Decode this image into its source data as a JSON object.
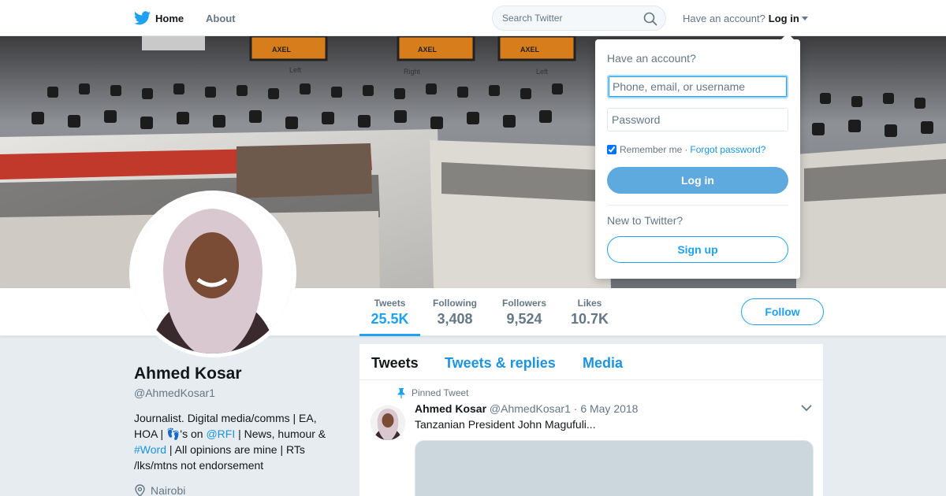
{
  "nav": {
    "home_label": "Home",
    "about_label": "About",
    "search_placeholder": "Search Twitter",
    "account_prompt": "Have an account?",
    "login_label": "Log in"
  },
  "colors": {
    "brand": "#1da1f2",
    "login_button": "#5ea9dd",
    "background": "#e6ecf0"
  },
  "icons": {
    "nav_home": "twitter-bird-icon",
    "search": "search-icon",
    "caret": "caret-down-icon",
    "pinned": "pin-icon",
    "location": "location-pin-icon",
    "tweet_menu": "chevron-down-icon"
  },
  "banner": {
    "vu_labels": [
      "Left",
      "Right",
      "Left"
    ],
    "meter_brand": "AXEL"
  },
  "stats": [
    {
      "label": "Tweets",
      "value": "25.5K"
    },
    {
      "label": "Following",
      "value": "3,408"
    },
    {
      "label": "Followers",
      "value": "9,524"
    },
    {
      "label": "Likes",
      "value": "10.7K"
    }
  ],
  "follow_label": "Follow",
  "profile": {
    "name": "Ahmed Kosar",
    "handle": "@AhmedKosar1",
    "bio_part1": "Journalist. Digital media/comms | EA, HOA | ",
    "bio_emoji": "👣",
    "bio_part2": "'s on ",
    "bio_mention": "@RFI",
    "bio_part3": " | News, humour & ",
    "bio_hashtag": "#Word",
    "bio_part4": " | All opinions are mine | RTs /lks/mtns not endorsement",
    "location": "Nairobi"
  },
  "timeline": {
    "tabs": [
      "Tweets",
      "Tweets & replies",
      "Media"
    ],
    "pinned_label": "Pinned Tweet",
    "tweet": {
      "author": "Ahmed Kosar",
      "handle": "@AhmedKosar1",
      "separator": "·",
      "date": "6 May 2018",
      "text": "Tanzanian President John Magufuli..."
    }
  },
  "login_dropdown": {
    "title": "Have an account?",
    "username_placeholder": "Phone, email, or username",
    "password_placeholder": "Password",
    "remember_label": "Remember me",
    "separator": "·",
    "forgot_label": "Forgot password?",
    "login_button": "Log in",
    "new_prompt": "New to Twitter?",
    "signup_button": "Sign up"
  }
}
